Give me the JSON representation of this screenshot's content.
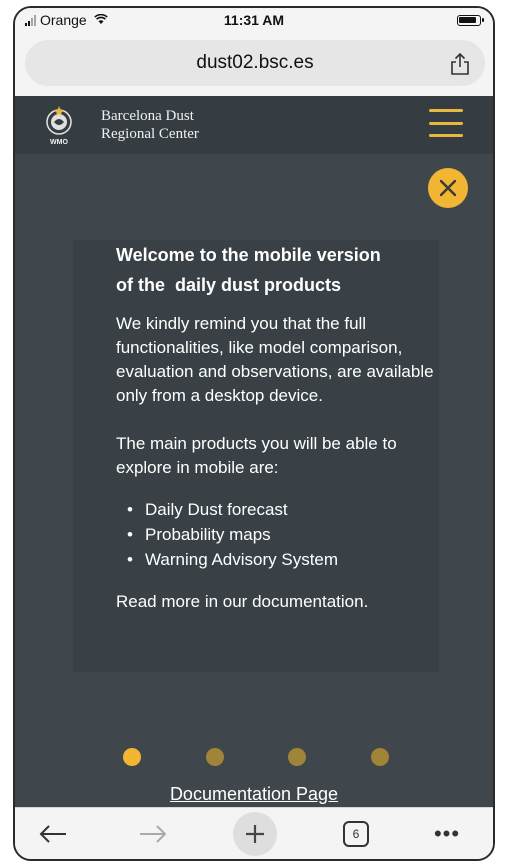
{
  "status_bar": {
    "carrier": "Orange",
    "time": "11:31 AM"
  },
  "browser": {
    "url": "dust02.bsc.es",
    "tab_count": "6"
  },
  "site": {
    "title_line1": "Barcelona Dust",
    "title_line2": "Regional Center",
    "logo_text": "WMO",
    "menu_color": "#e8b93c"
  },
  "modal": {
    "title_line1": "Welcome to the mobile version",
    "title_line2": "of the  daily dust products",
    "paragraph1": "We kindly remind you that the full functionalities, like model comparison, evaluation and observations, are available only from a desktop device.",
    "paragraph2": "The main products you will be able to explore in mobile are:",
    "list": [
      "Daily Dust forecast",
      "Probability maps",
      "Warning Advisory System"
    ],
    "paragraph3": "Read more in our documentation."
  },
  "pagination": {
    "pages": 4,
    "active_index": 0,
    "active_color": "#f2b632",
    "inactive_color": "#a08437"
  },
  "link": {
    "label": "Documentation Page"
  },
  "icons": {
    "close": "close-icon",
    "share": "share-icon",
    "menu": "hamburger-menu-icon",
    "back": "back-arrow-icon",
    "forward": "forward-arrow-icon",
    "new_tab": "plus-icon",
    "more": "more-icon"
  }
}
